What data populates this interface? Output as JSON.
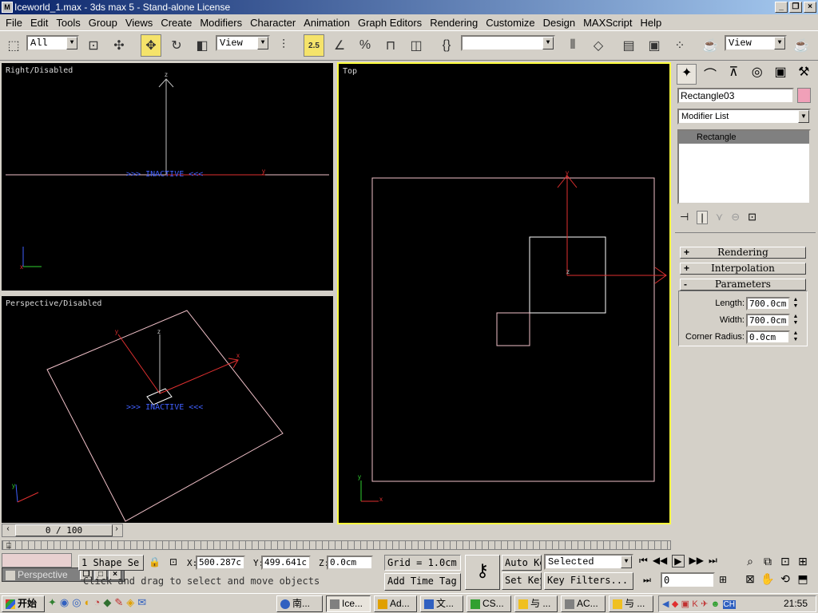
{
  "window": {
    "title": "Iceworld_1.max - 3ds max 5 - Stand-alone License",
    "app_icon": "3ds-max-icon"
  },
  "menu": [
    "File",
    "Edit",
    "Tools",
    "Group",
    "Views",
    "Create",
    "Modifiers",
    "Character",
    "Animation",
    "Graph Editors",
    "Rendering",
    "Customize",
    "Design",
    "MAXScript",
    "Help"
  ],
  "toolbar": {
    "selection_filter": "All",
    "reference_coord": "View",
    "snap_value": "2.5",
    "named_selection": "",
    "render_view": "View"
  },
  "viewports": {
    "right": {
      "label": "Right/Disabled",
      "inactive": ">>> INACTIVE <<<"
    },
    "perspective": {
      "label": "Perspective/Disabled",
      "inactive": ">>> INACTIVE <<<"
    },
    "top": {
      "label": "Top"
    }
  },
  "command_panel": {
    "object_name": "Rectangle03",
    "object_color": "#f0a0b8",
    "modifier_list": "Modifier List",
    "stack_items": [
      "Rectangle"
    ],
    "rollouts": [
      {
        "sign": "+",
        "title": "Rendering"
      },
      {
        "sign": "+",
        "title": "Interpolation"
      },
      {
        "sign": "-",
        "title": "Parameters"
      }
    ],
    "params": [
      {
        "label": "Length:",
        "value": "700.0cm"
      },
      {
        "label": "Width:",
        "value": "700.0cm"
      },
      {
        "label": "Corner Radius:",
        "value": "0.0cm"
      }
    ]
  },
  "timeline": {
    "frame_display": "0 / 100"
  },
  "status": {
    "selection_count": "1 Shape Se",
    "x_label": "X:",
    "x_value": "500.287c",
    "y_label": "Y:",
    "y_value": "499.641c",
    "z_label": "Z:",
    "z_value": "0.0cm",
    "grid": "Grid = 1.0cm",
    "auto_key": "Auto Key",
    "set_key": "Set Key",
    "key_mode": "Selected",
    "key_filters": "Key Filters...",
    "frame_value": "0",
    "prompt": "Click and drag to select and move objects",
    "add_time_tag": "Add Time Tag",
    "listener_title": "Perspective"
  },
  "taskbar": {
    "start": "开始",
    "clock": "21:55",
    "tasks": [
      "南...",
      "Ice...",
      "Ad...",
      "文...",
      "CS...",
      "与 ...",
      "AC...",
      "与 ..."
    ]
  },
  "colors": {
    "shape": "#f0c0c8",
    "axis_red": "#e03030",
    "axis_green": "#30d030",
    "inactive_blue": "#4060ff",
    "active_border": "#ffff40"
  }
}
